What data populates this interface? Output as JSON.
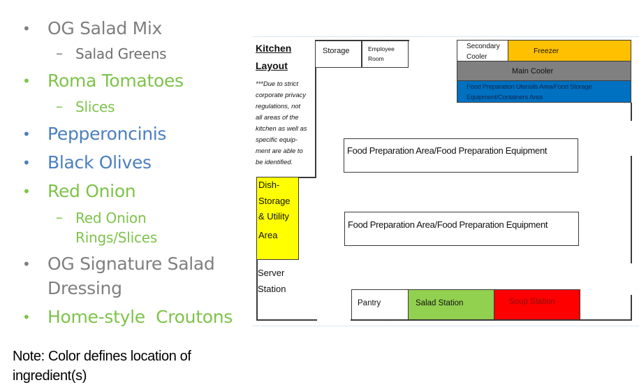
{
  "ingredients": [
    {
      "label": "OG Salad Mix",
      "color": "gray",
      "sub": [
        "Salad Greens"
      ]
    },
    {
      "label": "Roma Tomatoes",
      "color": "green",
      "sub": [
        "Slices"
      ]
    },
    {
      "label": "Pepperoncinis",
      "color": "blue",
      "sub": []
    },
    {
      "label": "Black Olives",
      "color": "blue",
      "sub": []
    },
    {
      "label": "Red Onion",
      "color": "green",
      "sub": [
        "Red Onion",
        "Rings/Slices"
      ]
    },
    {
      "label": "OG Signature Salad",
      "label_line2": "Dressing",
      "color": "gray",
      "sub": []
    },
    {
      "label": "Home-style  Croutons",
      "color": "green",
      "sub": []
    }
  ],
  "bullet_glyph": "•",
  "dash_glyph": "–",
  "note": {
    "line1": "Note: Color defines location of",
    "line2": "ingredient(s)"
  },
  "colors": {
    "gray_text": "#7f7f7f",
    "green_text": "#7ec34a",
    "blue_text": "#4a7fc0",
    "freezer": "#ffc000",
    "main_cooler": "#808080",
    "utensils_area": "#0070c0",
    "dish_storage": "#ffff00",
    "salad_station": "#92d050",
    "soup_station": "#ff0000"
  },
  "kitchen": {
    "title_line1": "Kitchen",
    "title_line2": "Layout",
    "disclaimer": "***Due to strict\ncorporate privacy\nregulations, not\nall areas of the\nkitchen as well as\nspecific equip-\nment are able to\nbe identified.",
    "areas": {
      "storage": "Storage",
      "employee_room_1": "Employee",
      "employee_room_2": "Room",
      "secondary_cooler_1": "Secondary",
      "secondary_cooler_2": "Cooler",
      "freezer": "Freezer",
      "main_cooler": "Main Cooler",
      "utensils_1": "Food Preparation Utensils Area/Food Storage",
      "utensils_2": "Equipment/Containers Area",
      "food_prep_1": "Food Preparation Area/Food Preparation Equipment",
      "food_prep_2": "Food Preparation Area/Food Preparation Equipment",
      "dish_storage_1": "Dish-",
      "dish_storage_2": "Storage",
      "dish_storage_3": "& Utility",
      "dish_storage_4": "Area",
      "server_station_1": "Server",
      "server_station_2": "Station",
      "pantry": "Pantry",
      "salad_station": "Salad Station",
      "soup_station": "Soup Station"
    }
  }
}
